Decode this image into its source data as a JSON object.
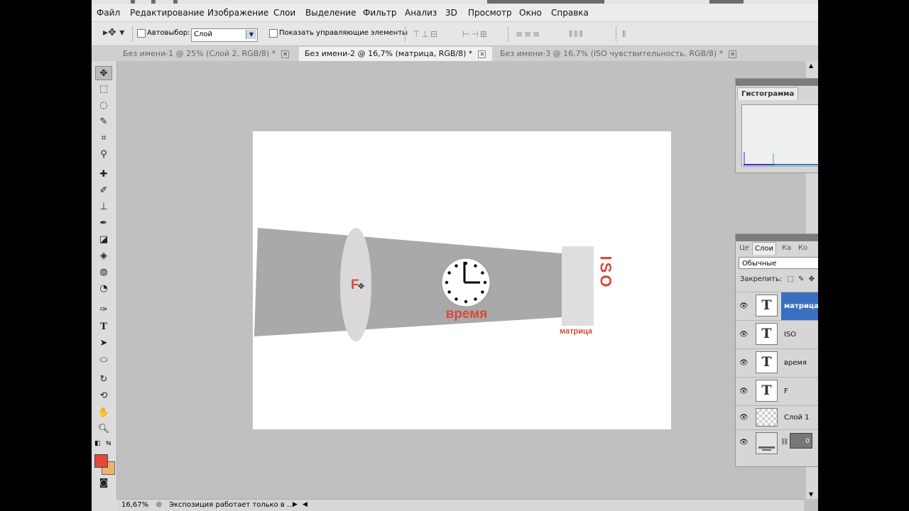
{
  "colors": {
    "foreground": "#e8473a",
    "background": "#f0b36a",
    "accent_selection": "#3a6fc0",
    "text_red": "#d94a3a"
  },
  "menu": [
    "Файл",
    "Редактирование",
    "Изображение",
    "Слои",
    "Выделение",
    "Фильтр",
    "Анализ",
    "3D",
    "Просмотр",
    "Окно",
    "Справка"
  ],
  "options": {
    "autoselect_label": "Автовыбор:",
    "autoselect_value": "Слой",
    "show_controls_label": "Показать управляющие элементы"
  },
  "doc_tabs": [
    {
      "label": "Без имени-1 @ 25% (Слой 2, RGB/8) *",
      "active": false
    },
    {
      "label": "Без имени-2 @ 16,7% (матрица, RGB/8) *",
      "active": true
    },
    {
      "label": "Без имени-3 @ 16,7% (ISO чувствительность, RGB/8) *",
      "active": false
    }
  ],
  "tools": [
    "move-icon",
    "marquee-icon",
    "lasso-icon",
    "quick-select-icon",
    "crop-icon",
    "eyedropper-icon",
    "healing-icon",
    "brush-icon",
    "stamp-icon",
    "history-brush-icon",
    "eraser-icon",
    "bucket-icon",
    "blur-icon",
    "dodge-icon",
    "pen-icon",
    "type-icon",
    "path-select-icon",
    "ellipse-icon",
    "3d-rotate-icon",
    "3d-orbit-icon",
    "hand-icon",
    "zoom-icon"
  ],
  "canvas": {
    "f_label": "F",
    "time_label": "время",
    "iso_label": "ISO",
    "matrix_label": "матрица"
  },
  "status": {
    "zoom": "16,67%",
    "info": "Экспозиция работает только в ..."
  },
  "histogram": {
    "tab": "Гистограмма"
  },
  "layers_panel": {
    "tabs": [
      "Це",
      "Слои",
      "Ка",
      "Ко"
    ],
    "blend_mode": "Обычные",
    "lock_label": "Закрепить:",
    "layers": [
      {
        "name": "матрица",
        "kind": "text",
        "selected": true
      },
      {
        "name": "ISO",
        "kind": "text",
        "selected": false
      },
      {
        "name": "время",
        "kind": "text",
        "selected": false
      },
      {
        "name": "F",
        "kind": "text",
        "selected": false
      },
      {
        "name": "Слой 1",
        "kind": "raster",
        "selected": false
      },
      {
        "name": "",
        "kind": "background",
        "selected": false
      }
    ],
    "fill_value": "0"
  }
}
